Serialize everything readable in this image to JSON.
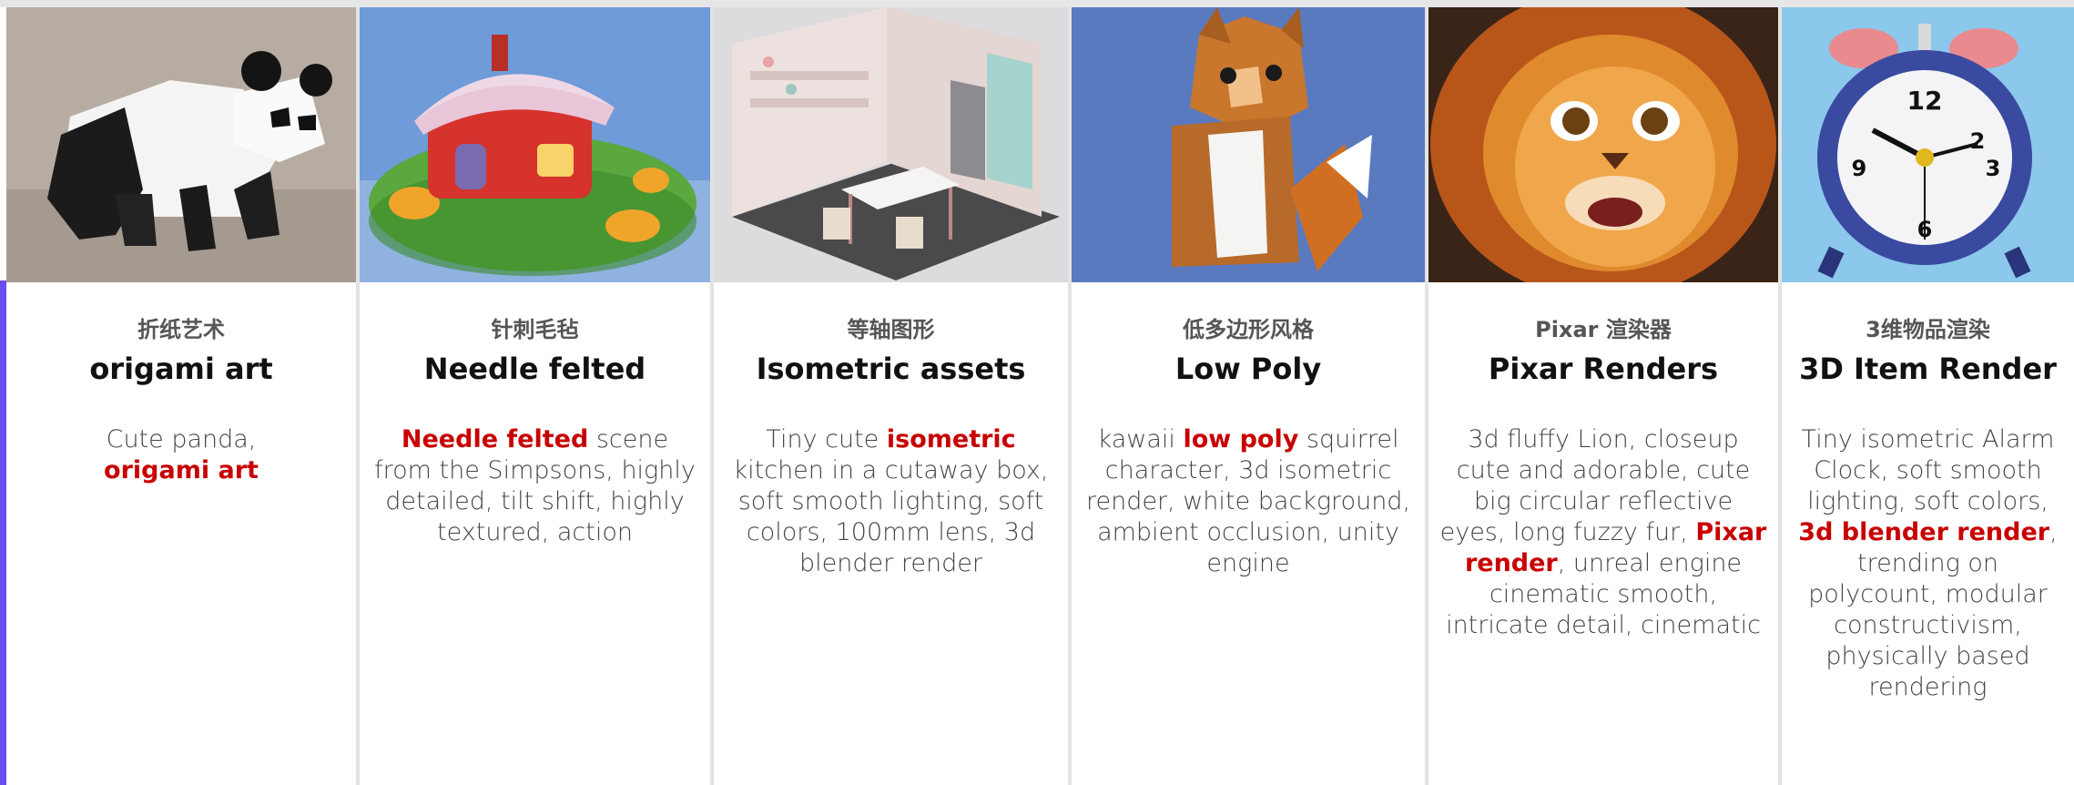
{
  "colors": {
    "accent": "#6a4ff0",
    "keyword": "#c80000",
    "title": "#111111",
    "subtitle": "#555555",
    "body": "#444444"
  },
  "cards": [
    {
      "cn": "折纸艺术",
      "title": "origami art",
      "image_icon": "origami-panda-image",
      "prompt": {
        "p1": "Cute panda, ",
        "k1": "origami art",
        "p2": "",
        "k2": "",
        "p3": ""
      }
    },
    {
      "cn": "针刺毛毡",
      "title": "Needle felted",
      "image_icon": "felted-house-image",
      "prompt": {
        "p1": "",
        "k1": "Needle felted",
        "p2": " scene from the Simpsons, highly detailed, tilt shift, highly textured, action",
        "k2": "",
        "p3": ""
      }
    },
    {
      "cn": "等轴图形",
      "title": "Isometric assets",
      "image_icon": "isometric-kitchen-image",
      "prompt": {
        "p1": "Tiny cute ",
        "k1": "isometric",
        "p2": " kitchen in a cutaway box, soft smooth lighting, soft colors, 100mm lens, 3d blender render",
        "k2": "",
        "p3": ""
      }
    },
    {
      "cn": "低多边形风格",
      "title": "Low Poly",
      "image_icon": "low-poly-squirrel-image",
      "prompt": {
        "p1": "kawaii ",
        "k1": "low poly",
        "p2": " squirrel character, 3d isometric render, white background, ambient occlusion, unity engine",
        "k2": "",
        "p3": ""
      }
    },
    {
      "cn": "Pixar 渲染器",
      "title": "Pixar Renders",
      "image_icon": "pixar-lion-image",
      "prompt": {
        "p1": "3d fluffy Lion, closeup cute and adorable, cute big circular reflective eyes, long fuzzy fur, ",
        "k1": "Pixar render",
        "p2": ", unreal engine cinematic smooth, intricate detail, cinematic",
        "k2": "",
        "p3": ""
      }
    },
    {
      "cn": "3维物品渲染",
      "title": "3D Item Render",
      "image_icon": "alarm-clock-image",
      "prompt": {
        "p1": "Tiny isometric Alarm Clock, soft smooth lighting, soft colors, ",
        "k1": "3d blender render",
        "p2": ", trending on polycount, modular constructivism, physically based rendering",
        "k2": "",
        "p3": ""
      }
    }
  ]
}
